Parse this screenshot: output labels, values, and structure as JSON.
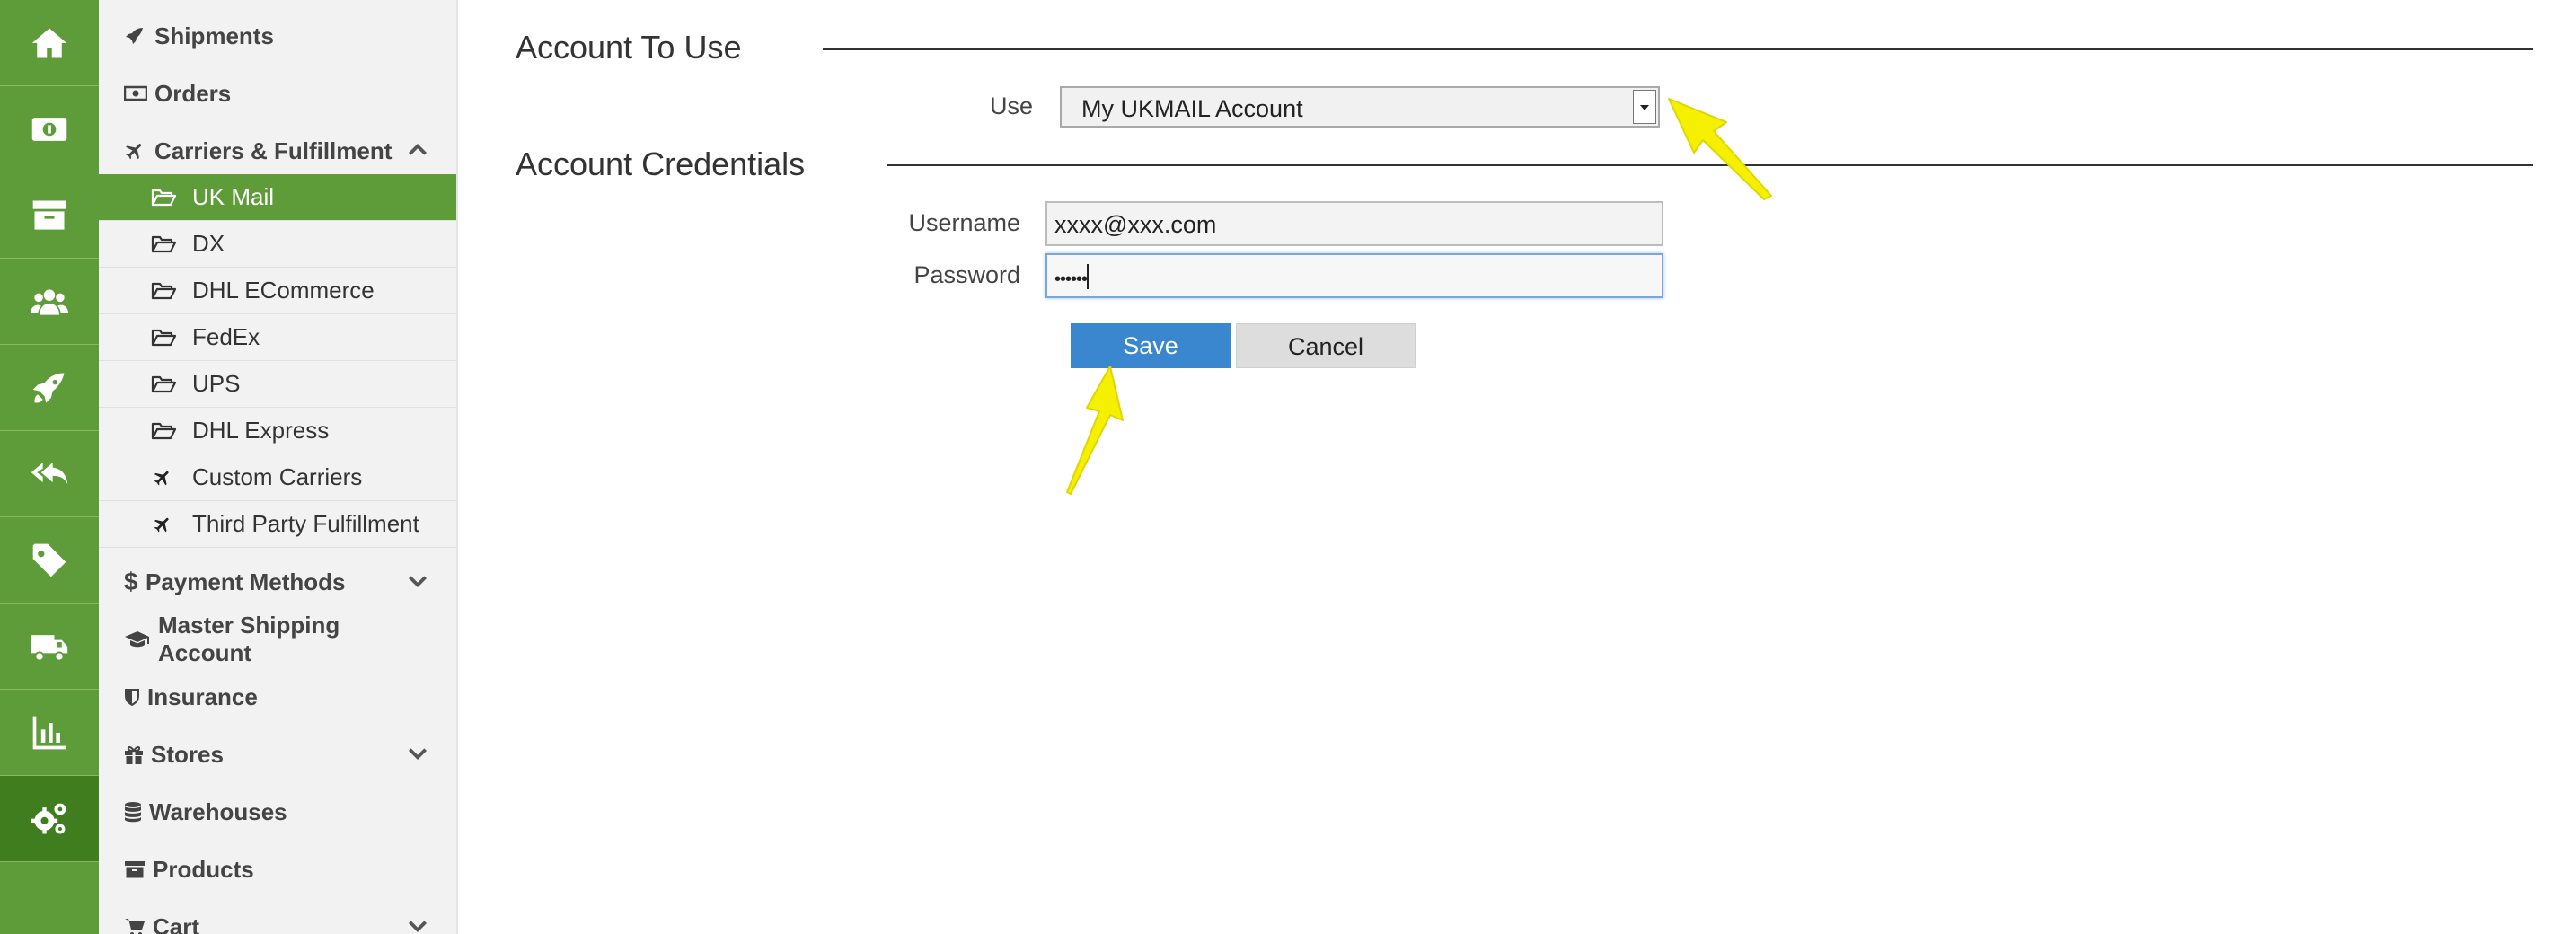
{
  "rail": {
    "icons": [
      "home-icon",
      "money-icon",
      "archive-icon",
      "users-icon",
      "rocket-icon",
      "reply-all-icon",
      "tag-icon",
      "truck-icon",
      "bar-chart-icon",
      "cogs-icon"
    ],
    "active_index": 9
  },
  "sidebar": {
    "shipments": "Shipments",
    "orders": "Orders",
    "carriers": "Carriers & Fulfillment",
    "carrier_items": [
      "UK Mail",
      "DX",
      "DHL ECommerce",
      "FedEx",
      "UPS",
      "DHL Express",
      "Custom Carriers",
      "Third Party Fulfillment"
    ],
    "payment_methods": "Payment Methods",
    "master_shipping": "Master Shipping Account",
    "insurance": "Insurance",
    "stores": "Stores",
    "warehouses": "Warehouses",
    "products": "Products",
    "cart": "Cart"
  },
  "main": {
    "account_heading": "Account To Use",
    "use_label": "Use",
    "use_value": "My UKMAIL Account",
    "credentials_heading": "Account Credentials",
    "username_label": "Username",
    "username_value": "xxxx@xxx.com",
    "password_label": "Password",
    "password_value": "••••••",
    "save_label": "Save",
    "cancel_label": "Cancel"
  },
  "colors": {
    "rail": "#5e9c3a",
    "active": "#5e9c3a",
    "save": "#3a87cf",
    "annotation_arrow": "#f5f000"
  }
}
